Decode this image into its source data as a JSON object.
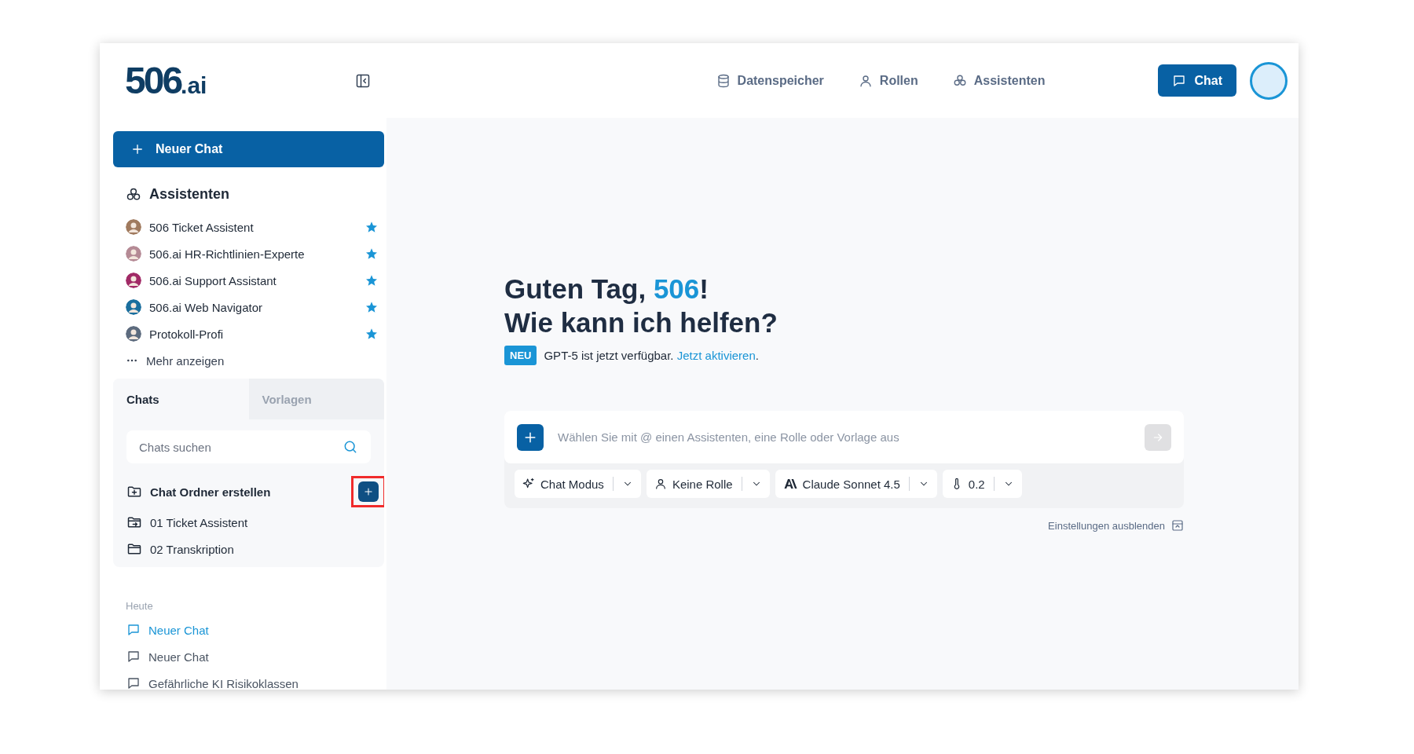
{
  "logo": {
    "main": "506",
    "suffix": ".ai"
  },
  "nav": [
    {
      "kind": "database",
      "label": "Datenspeicher"
    },
    {
      "kind": "user",
      "label": "Rollen"
    },
    {
      "kind": "cluster",
      "label": "Assistenten"
    }
  ],
  "chat_button": "Chat",
  "sidebar": {
    "new_chat": "Neuer Chat",
    "assistants_title": "Assistenten",
    "assistants": [
      {
        "name": "506 Ticket Assistent",
        "color": "#a07a5e",
        "favorite": true
      },
      {
        "name": "506.ai HR-Richtlinien-Experte",
        "color": "#b58a95",
        "favorite": true
      },
      {
        "name": "506.ai Support Assistant",
        "color": "#a12a66",
        "favorite": true
      },
      {
        "name": "506.ai Web Navigator",
        "color": "#1b6f9e",
        "favorite": true
      },
      {
        "name": "Protokoll-Profi",
        "color": "#5d6b7e",
        "favorite": true
      }
    ],
    "more": "Mehr anzeigen",
    "tabs": [
      {
        "label": "Chats",
        "selected": true
      },
      {
        "label": "Vorlagen",
        "selected": false
      }
    ],
    "search": {
      "placeholder": "Chats suchen"
    },
    "create_folder": {
      "label": "Chat Ordner erstellen",
      "highlighted": true
    },
    "folders": [
      {
        "kind": "shared",
        "name": "01 Ticket Assistent"
      },
      {
        "kind": "plain",
        "name": "02 Transkription"
      }
    ],
    "history_title": "Heute",
    "history": [
      {
        "title": "Neuer Chat",
        "selected": true
      },
      {
        "title": "Neuer Chat",
        "selected": false
      },
      {
        "title": "Gefährliche KI Risikoklassen",
        "selected": false
      }
    ]
  },
  "main": {
    "greeting": "Guten Tag, *506*!",
    "question": "Wie kann ich helfen?",
    "announcement": {
      "badge": "NEU",
      "text": "GPT-5 ist jetzt verfügbar.",
      "link": "Jetzt aktivieren",
      "after": "."
    },
    "input": {
      "placeholder": "Wählen Sie mit @ einen Assistenten, eine Rolle oder Vorlage aus",
      "send_disabled": true
    },
    "settings": [
      {
        "kind": "mode",
        "label": "Chat Modus"
      },
      {
        "kind": "role",
        "label": "Keine Rolle"
      },
      {
        "kind": "model",
        "label": "Claude Sonnet 4.5"
      },
      {
        "kind": "temperature",
        "label": "0.2"
      }
    ],
    "hide_settings": "Einstellungen ausblenden"
  }
}
